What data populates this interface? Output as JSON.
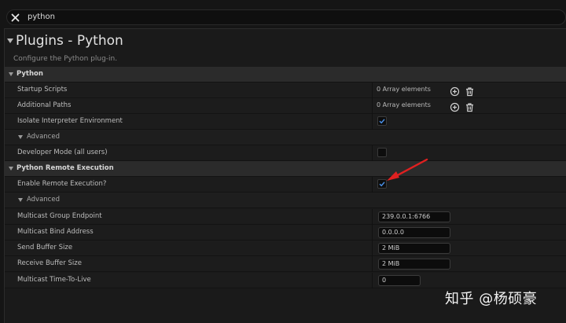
{
  "search": {
    "query": "python"
  },
  "header": {
    "title": "Plugins - Python",
    "description": "Configure the Python plug-in."
  },
  "categories": {
    "python": {
      "label": "Python"
    },
    "remote": {
      "label": "Python Remote Execution"
    }
  },
  "rows": {
    "startup_scripts": {
      "label": "Startup Scripts",
      "value": "0 Array elements"
    },
    "additional_paths": {
      "label": "Additional Paths",
      "value": "0 Array elements"
    },
    "isolate_env": {
      "label": "Isolate Interpreter Environment",
      "checked": true
    },
    "advanced_1": {
      "label": "Advanced"
    },
    "developer_mode": {
      "label": "Developer Mode (all users)",
      "checked": false
    },
    "enable_remote": {
      "label": "Enable Remote Execution?",
      "checked": true
    },
    "advanced_2": {
      "label": "Advanced"
    },
    "multicast_endpoint": {
      "label": "Multicast Group Endpoint",
      "value": "239.0.0.1:6766"
    },
    "multicast_bind": {
      "label": "Multicast Bind Address",
      "value": "0.0.0.0"
    },
    "send_buffer": {
      "label": "Send Buffer Size",
      "value": "2 MiB"
    },
    "receive_buffer": {
      "label": "Receive Buffer Size",
      "value": "2 MiB"
    },
    "ttl": {
      "label": "Multicast Time-To-Live",
      "value": "0"
    }
  },
  "watermark": {
    "text": "知乎 @杨硕豪"
  },
  "colors": {
    "accent_check": "#3d7fd6",
    "annotation": "#e02020"
  }
}
